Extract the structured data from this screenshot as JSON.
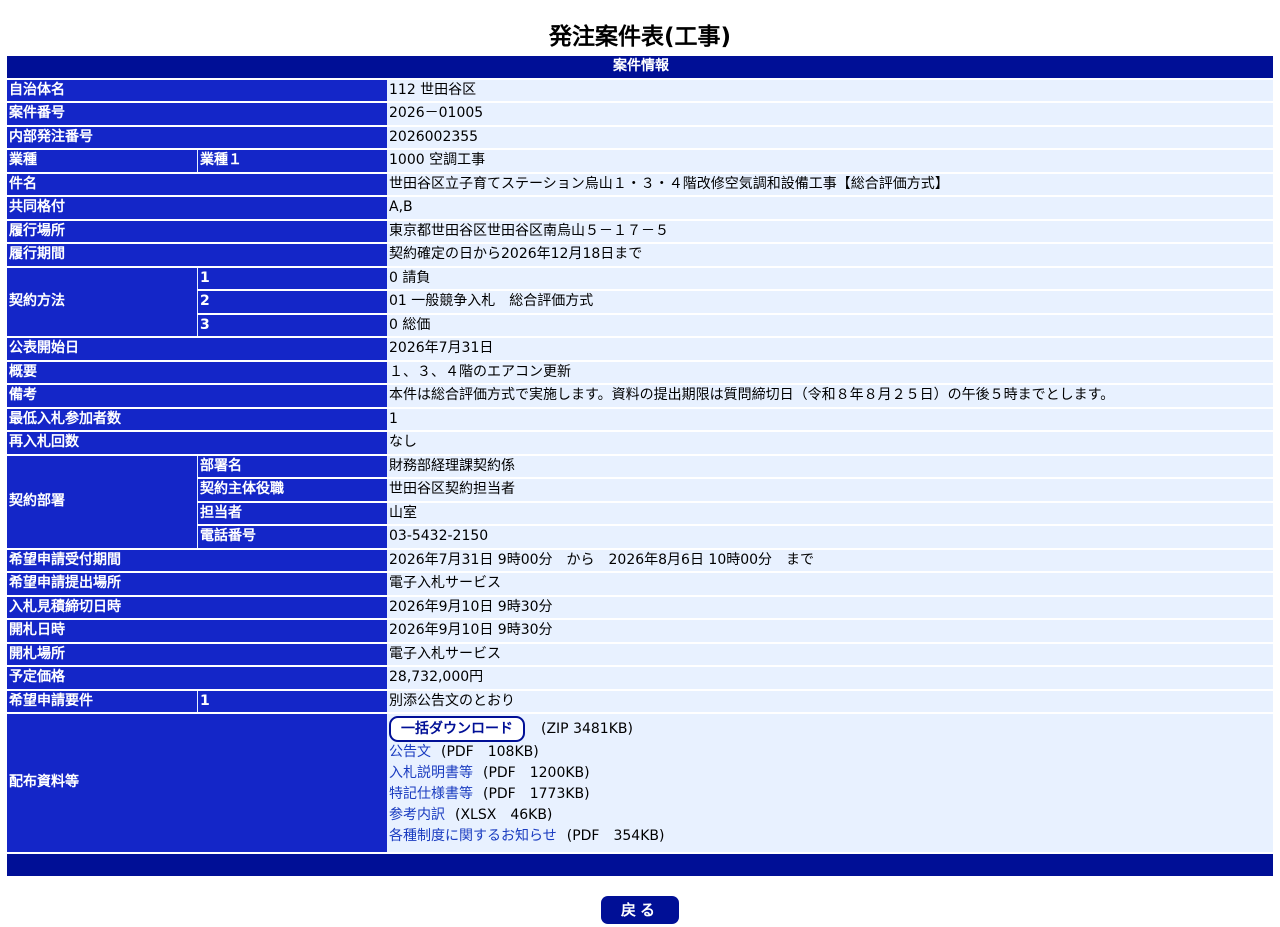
{
  "title": "発注案件表(工事)",
  "section_header": "案件情報",
  "rows": {
    "jichitai": {
      "label": "自治体名",
      "value": "112 世田谷区"
    },
    "anken_no": {
      "label": "案件番号",
      "value": "2026－01005"
    },
    "naibu_no": {
      "label": "内部発注番号",
      "value": "2026002355"
    },
    "gyoshu": {
      "label": "業種",
      "sublabel": "業種１",
      "value": "1000 空調工事"
    },
    "kenmei": {
      "label": "件名",
      "value": "世田谷区立子育てステーション烏山１・３・４階改修空気調和設備工事【総合評価方式】"
    },
    "kyodo": {
      "label": "共同格付",
      "value": "A,B"
    },
    "basho": {
      "label": "履行場所",
      "value": "東京都世田谷区世田谷区南烏山５－１７－５"
    },
    "kikan": {
      "label": "履行期間",
      "value": "契約確定の日から2026年12月18日まで"
    },
    "hoho": {
      "label": "契約方法",
      "items": [
        {
          "sublabel": "1",
          "value": "0 請負"
        },
        {
          "sublabel": "2",
          "value": "01 一般競争入札　総合評価方式"
        },
        {
          "sublabel": "3",
          "value": "0 総価"
        }
      ]
    },
    "kohyo": {
      "label": "公表開始日",
      "value": "2026年7月31日"
    },
    "gaiyo": {
      "label": "概要",
      "value": "１、３、４階のエアコン更新"
    },
    "biko": {
      "label": "備考",
      "value": "本件は総合評価方式で実施します。資料の提出期限は質問締切日（令和８年８月２５日）の午後５時までとします。"
    },
    "saitei": {
      "label": "最低入札参加者数",
      "value": "1"
    },
    "sainyu": {
      "label": "再入札回数",
      "value": "なし"
    },
    "busho": {
      "label": "契約部署",
      "items": [
        {
          "sublabel": "部署名",
          "value": "財務部経理課契約係"
        },
        {
          "sublabel": "契約主体役職",
          "value": "世田谷区契約担当者"
        },
        {
          "sublabel": "担当者",
          "value": "山室"
        },
        {
          "sublabel": "電話番号",
          "value": "03-5432-2150"
        }
      ]
    },
    "uketsuke": {
      "label": "希望申請受付期間",
      "value": "2026年7月31日 9時00分　から　2026年8月6日 10時00分　まで"
    },
    "teishutsu": {
      "label": "希望申請提出場所",
      "value": "電子入札サービス"
    },
    "shimekiri": {
      "label": "入札見積締切日時",
      "value": "2026年9月10日 9時30分"
    },
    "kaisatsu": {
      "label": "開札日時",
      "value": "2026年9月10日 9時30分"
    },
    "kaisatsu_basho": {
      "label": "開札場所",
      "value": "電子入札サービス"
    },
    "yotei": {
      "label": "予定価格",
      "value": "28,732,000円"
    },
    "yoken": {
      "label": "希望申請要件",
      "sublabel": "1",
      "value": "別添公告文のとおり"
    },
    "haifu": {
      "label": "配布資料等",
      "download_label": "一括ダウンロード",
      "download_meta": "(ZIP 3481KB)",
      "docs": [
        {
          "name": "公告文",
          "meta": "(PDF　108KB)"
        },
        {
          "name": "入札説明書等",
          "meta": "(PDF　1200KB)"
        },
        {
          "name": "特記仕様書等",
          "meta": "(PDF　1773KB)"
        },
        {
          "name": "参考内訳",
          "meta": "(XLSX　46KB)"
        },
        {
          "name": "各種制度に関するお知らせ",
          "meta": "(PDF　354KB)"
        }
      ]
    }
  },
  "back_label": "戻る",
  "colors": {
    "header": "#000f96",
    "label": "#1426c8",
    "value_bg": "#e8f1ff",
    "link": "#1a3cc0"
  }
}
